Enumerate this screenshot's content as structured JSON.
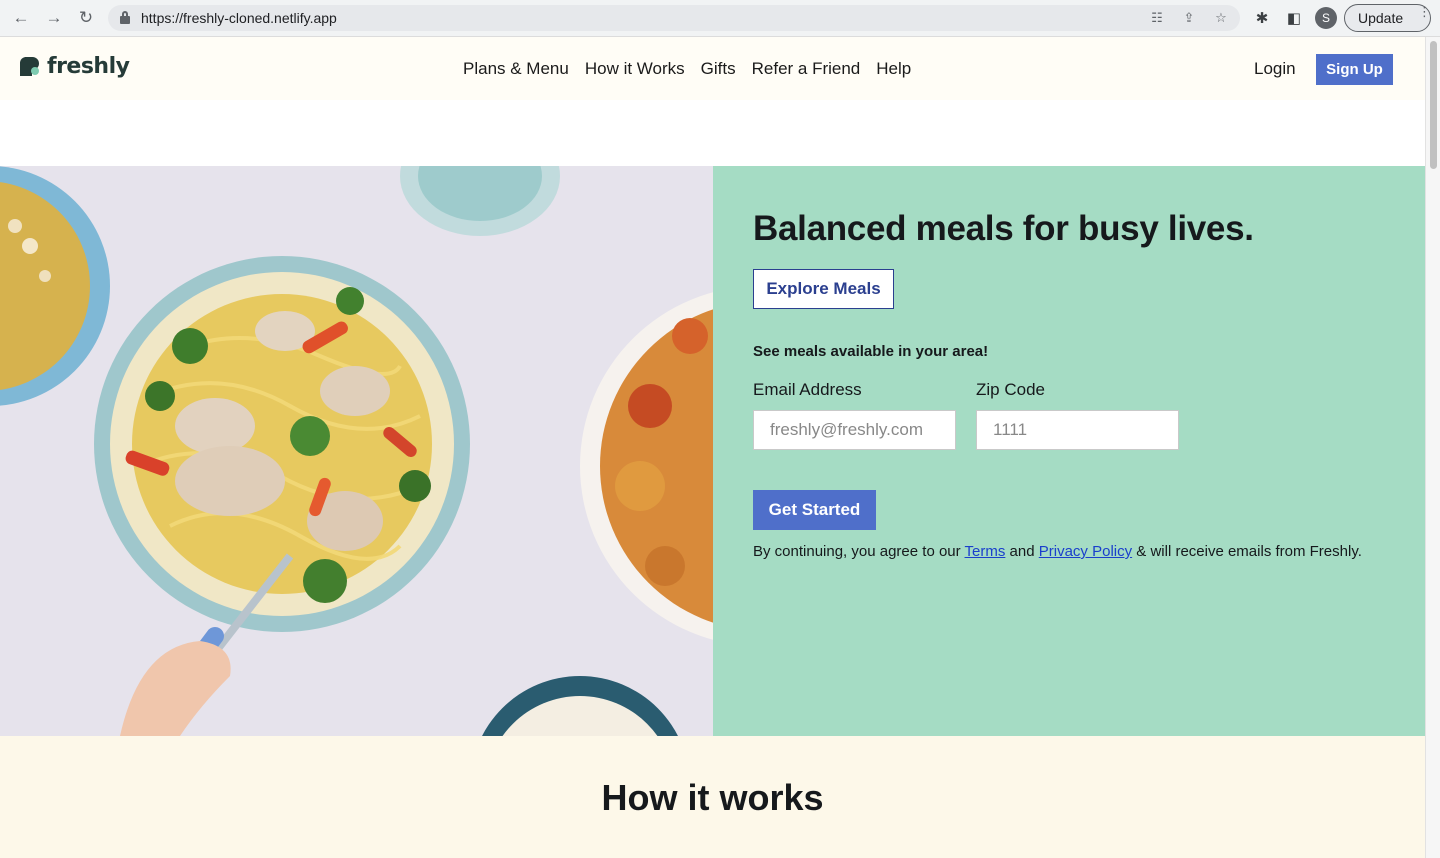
{
  "browser": {
    "url": "https://freshly-cloned.netlify.app",
    "profile_initial": "S",
    "update_label": "Update"
  },
  "header": {
    "logo_text": "freshly",
    "nav": [
      "Plans & Menu",
      "How it Works",
      "Gifts",
      "Refer a Friend",
      "Help"
    ],
    "login_label": "Login",
    "signup_label": "Sign Up"
  },
  "hero": {
    "title": "Balanced meals for busy lives.",
    "explore_label": "Explore Meals",
    "see_meals": "See meals available in your area!",
    "email_label": "Email Address",
    "email_placeholder": "freshly@freshly.com",
    "zip_label": "Zip Code",
    "zip_placeholder": "1111",
    "cta_label": "Get Started",
    "legal": {
      "prefix": "By continuing, you agree to our ",
      "terms": "Terms",
      "and": " and ",
      "privacy": "Privacy Policy",
      "suffix": " & will receive emails from Freshly."
    }
  },
  "how": {
    "title": "How it works"
  },
  "colors": {
    "accent": "#4f6fca",
    "panel": "#a5dcc4",
    "header_bg": "#fffdf6",
    "section_bg": "#fdf8e9"
  }
}
